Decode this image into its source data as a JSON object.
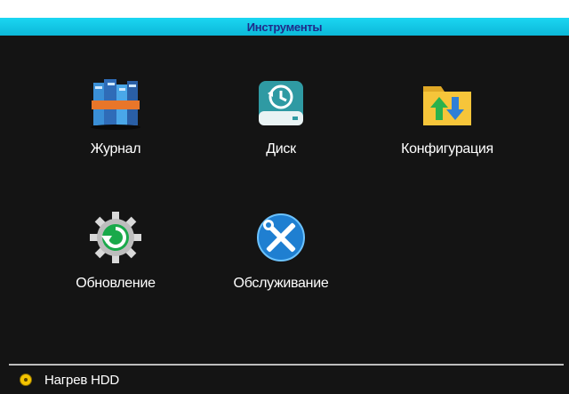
{
  "window": {
    "title": "Инструменты"
  },
  "tools": [
    {
      "label": "Журнал",
      "icon": "journal-books-icon"
    },
    {
      "label": "Диск",
      "icon": "disk-history-icon"
    },
    {
      "label": "Конфигурация",
      "icon": "config-folder-arrows-icon"
    },
    {
      "label": "Обновление",
      "icon": "update-gear-icon"
    },
    {
      "label": "Обслуживание",
      "icon": "maintenance-tools-icon"
    }
  ],
  "options": {
    "hdd_heating": {
      "label": "Нагрев HDD",
      "selected": true
    }
  },
  "colors": {
    "title_bar": "#1bd6f2",
    "title_text": "#1f2a8a",
    "panel": "#141414",
    "radio": "#f4c400"
  }
}
